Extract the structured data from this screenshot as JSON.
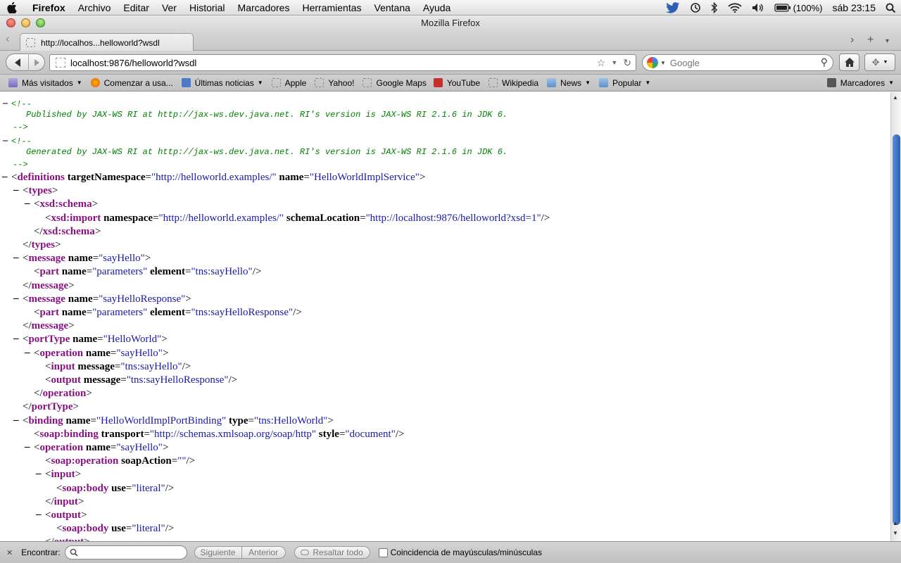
{
  "menubar": {
    "app": "Firefox",
    "items": [
      "Archivo",
      "Editar",
      "Ver",
      "Historial",
      "Marcadores",
      "Herramientas",
      "Ventana",
      "Ayuda"
    ],
    "battery": "(100%)",
    "clock": "sáb 23:15"
  },
  "window": {
    "title": "Mozilla Firefox"
  },
  "tab": {
    "title": "http://localhos...helloworld?wsdl"
  },
  "urlbar": {
    "url": "localhost:9876/helloworld?wsdl"
  },
  "search": {
    "placeholder": "Google"
  },
  "bookmarks": {
    "items": [
      {
        "label": "Más visitados",
        "icon": "folder-icon",
        "dropdown": true
      },
      {
        "label": "Comenzar a usa...",
        "icon": "firefox-icon"
      },
      {
        "label": "Últimas noticias",
        "icon": "rss-icon",
        "dropdown": true
      },
      {
        "label": "Apple",
        "icon": "page-icon"
      },
      {
        "label": "Yahoo!",
        "icon": "page-icon"
      },
      {
        "label": "Google Maps",
        "icon": "page-icon"
      },
      {
        "label": "YouTube",
        "icon": "youtube-icon"
      },
      {
        "label": "Wikipedia",
        "icon": "page-icon"
      },
      {
        "label": "News",
        "icon": "folder-icon",
        "dropdown": true
      },
      {
        "label": "Popular",
        "icon": "folder-icon",
        "dropdown": true
      }
    ],
    "menu_label": "Marcadores"
  },
  "xml": {
    "comments": [
      {
        "open": "<!--",
        "text": "Published by JAX-WS RI at http://jax-ws.dev.java.net. RI's version is JAX-WS RI 2.1.6 in JDK 6.",
        "close": "-->"
      },
      {
        "open": "<!--",
        "text": "Generated by JAX-WS RI at http://jax-ws.dev.java.net. RI's version is JAX-WS RI 2.1.6 in JDK 6.",
        "close": "-->"
      }
    ],
    "lines": [
      {
        "toggle": "–",
        "tag": "definitions",
        "close": false,
        "attrs": [
          {
            "n": "targetNamespace",
            "v": "http://helloworld.examples/"
          },
          {
            "n": "name",
            "v": "HelloWorldImplService"
          }
        ],
        "end": ">"
      },
      {
        "toggle": "–",
        "tag": "types",
        "close": false,
        "attrs": [],
        "end": ">"
      },
      {
        "toggle": "–",
        "tag": "xsd:schema",
        "close": false,
        "attrs": [],
        "end": ">"
      },
      {
        "toggle": "",
        "tag": "xsd:import",
        "close": false,
        "attrs": [
          {
            "n": "namespace",
            "v": "http://helloworld.examples/"
          },
          {
            "n": "schemaLocation",
            "v": "http://localhost:9876/helloworld?xsd=1"
          }
        ],
        "end": "/>"
      },
      {
        "toggle": "",
        "tag": "xsd:schema",
        "close": true,
        "attrs": [],
        "end": ">"
      },
      {
        "toggle": "",
        "tag": "types",
        "close": true,
        "attrs": [],
        "end": ">"
      },
      {
        "toggle": "–",
        "tag": "message",
        "close": false,
        "attrs": [
          {
            "n": "name",
            "v": "sayHello"
          }
        ],
        "end": ">"
      },
      {
        "toggle": "",
        "tag": "part",
        "close": false,
        "attrs": [
          {
            "n": "name",
            "v": "parameters"
          },
          {
            "n": "element",
            "v": "tns:sayHello"
          }
        ],
        "end": "/>"
      },
      {
        "toggle": "",
        "tag": "message",
        "close": true,
        "attrs": [],
        "end": ">"
      },
      {
        "toggle": "–",
        "tag": "message",
        "close": false,
        "attrs": [
          {
            "n": "name",
            "v": "sayHelloResponse"
          }
        ],
        "end": ">"
      },
      {
        "toggle": "",
        "tag": "part",
        "close": false,
        "attrs": [
          {
            "n": "name",
            "v": "parameters"
          },
          {
            "n": "element",
            "v": "tns:sayHelloResponse"
          }
        ],
        "end": "/>"
      },
      {
        "toggle": "",
        "tag": "message",
        "close": true,
        "attrs": [],
        "end": ">"
      },
      {
        "toggle": "–",
        "tag": "portType",
        "close": false,
        "attrs": [
          {
            "n": "name",
            "v": "HelloWorld"
          }
        ],
        "end": ">"
      },
      {
        "toggle": "–",
        "tag": "operation",
        "close": false,
        "attrs": [
          {
            "n": "name",
            "v": "sayHello"
          }
        ],
        "end": ">"
      },
      {
        "toggle": "",
        "tag": "input",
        "close": false,
        "attrs": [
          {
            "n": "message",
            "v": "tns:sayHello"
          }
        ],
        "end": "/>"
      },
      {
        "toggle": "",
        "tag": "output",
        "close": false,
        "attrs": [
          {
            "n": "message",
            "v": "tns:sayHelloResponse"
          }
        ],
        "end": "/>"
      },
      {
        "toggle": "",
        "tag": "operation",
        "close": true,
        "attrs": [],
        "end": ">"
      },
      {
        "toggle": "",
        "tag": "portType",
        "close": true,
        "attrs": [],
        "end": ">"
      },
      {
        "toggle": "–",
        "tag": "binding",
        "close": false,
        "attrs": [
          {
            "n": "name",
            "v": "HelloWorldImplPortBinding"
          },
          {
            "n": "type",
            "v": "tns:HelloWorld"
          }
        ],
        "end": ">"
      },
      {
        "toggle": "",
        "tag": "soap:binding",
        "close": false,
        "attrs": [
          {
            "n": "transport",
            "v": "http://schemas.xmlsoap.org/soap/http"
          },
          {
            "n": "style",
            "v": "document"
          }
        ],
        "end": "/>"
      },
      {
        "toggle": "–",
        "tag": "operation",
        "close": false,
        "attrs": [
          {
            "n": "name",
            "v": "sayHello"
          }
        ],
        "end": ">"
      },
      {
        "toggle": "",
        "tag": "soap:operation",
        "close": false,
        "attrs": [
          {
            "n": "soapAction",
            "v": ""
          }
        ],
        "end": "/>"
      },
      {
        "toggle": "–",
        "tag": "input",
        "close": false,
        "attrs": [],
        "end": ">"
      },
      {
        "toggle": "",
        "tag": "soap:body",
        "close": false,
        "attrs": [
          {
            "n": "use",
            "v": "literal"
          }
        ],
        "end": "/>"
      },
      {
        "toggle": "",
        "tag": "input",
        "close": true,
        "attrs": [],
        "end": ">"
      },
      {
        "toggle": "–",
        "tag": "output",
        "close": false,
        "attrs": [],
        "end": ">"
      },
      {
        "toggle": "",
        "tag": "soap:body",
        "close": false,
        "attrs": [
          {
            "n": "use",
            "v": "literal"
          }
        ],
        "end": "/>"
      },
      {
        "toggle": "",
        "tag": "output",
        "close": true,
        "attrs": [],
        "end": ">"
      }
    ]
  },
  "findbar": {
    "label": "Encontrar:",
    "next": "Siguiente",
    "prev": "Anterior",
    "highlight": "Resaltar todo",
    "match_case": "Coincidencia de mayúsculas/minúsculas"
  }
}
